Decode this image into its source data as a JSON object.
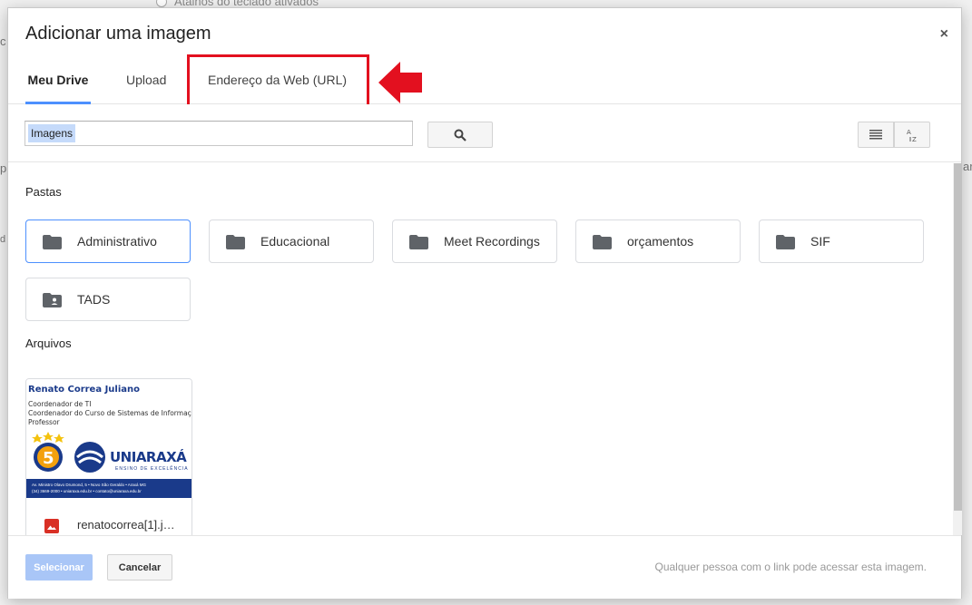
{
  "background": {
    "top_text": "Atalhos do teclado ativados"
  },
  "dialog": {
    "title": "Adicionar uma imagem",
    "close_label": "×"
  },
  "tabs": [
    {
      "label": "Meu Drive",
      "active": true
    },
    {
      "label": "Upload",
      "active": false
    },
    {
      "label": "Endereço da Web (URL)",
      "active": false
    }
  ],
  "search": {
    "value": "Imagens"
  },
  "sections": {
    "folders_label": "Pastas",
    "files_label": "Arquivos"
  },
  "folders": [
    {
      "name": "Administrativo",
      "selected": true,
      "icon": "folder-icon"
    },
    {
      "name": "Educacional",
      "selected": false,
      "icon": "folder-icon"
    },
    {
      "name": "Meet Recordings",
      "selected": false,
      "icon": "folder-icon"
    },
    {
      "name": "orçamentos",
      "selected": false,
      "icon": "folder-icon"
    },
    {
      "name": "SIF",
      "selected": false,
      "icon": "folder-icon"
    },
    {
      "name": "TADS",
      "selected": false,
      "icon": "shared-folder-icon"
    }
  ],
  "files": [
    {
      "name": "renatocorrea[1].j…",
      "icon": "image-icon",
      "thumbnail": {
        "person": "Renato Correa Juliano",
        "lines": [
          "Coordenador de TI",
          "Coordenador do Curso de Sistemas de Informação",
          "Professor"
        ],
        "logo": "UNIARAXÁ",
        "logo_sub": "ENSINO DE EXCELÊNCIA",
        "address": "Av. Ministro Olavo Drumond, 5 • Novo São Geraldo • Araxá MG",
        "contact": "(34) 3669-2000 • uniaraxa.edu.br • contato@uniaraxa.edu.br",
        "badge_number": "5"
      }
    }
  ],
  "footer": {
    "select_label": "Selecionar",
    "cancel_label": "Cancelar",
    "note": "Qualquer pessoa com o link pode acessar esta imagem."
  },
  "colors": {
    "accent": "#4d90fe",
    "highlight": "#e3101f",
    "brand": "#1a3a8a"
  }
}
